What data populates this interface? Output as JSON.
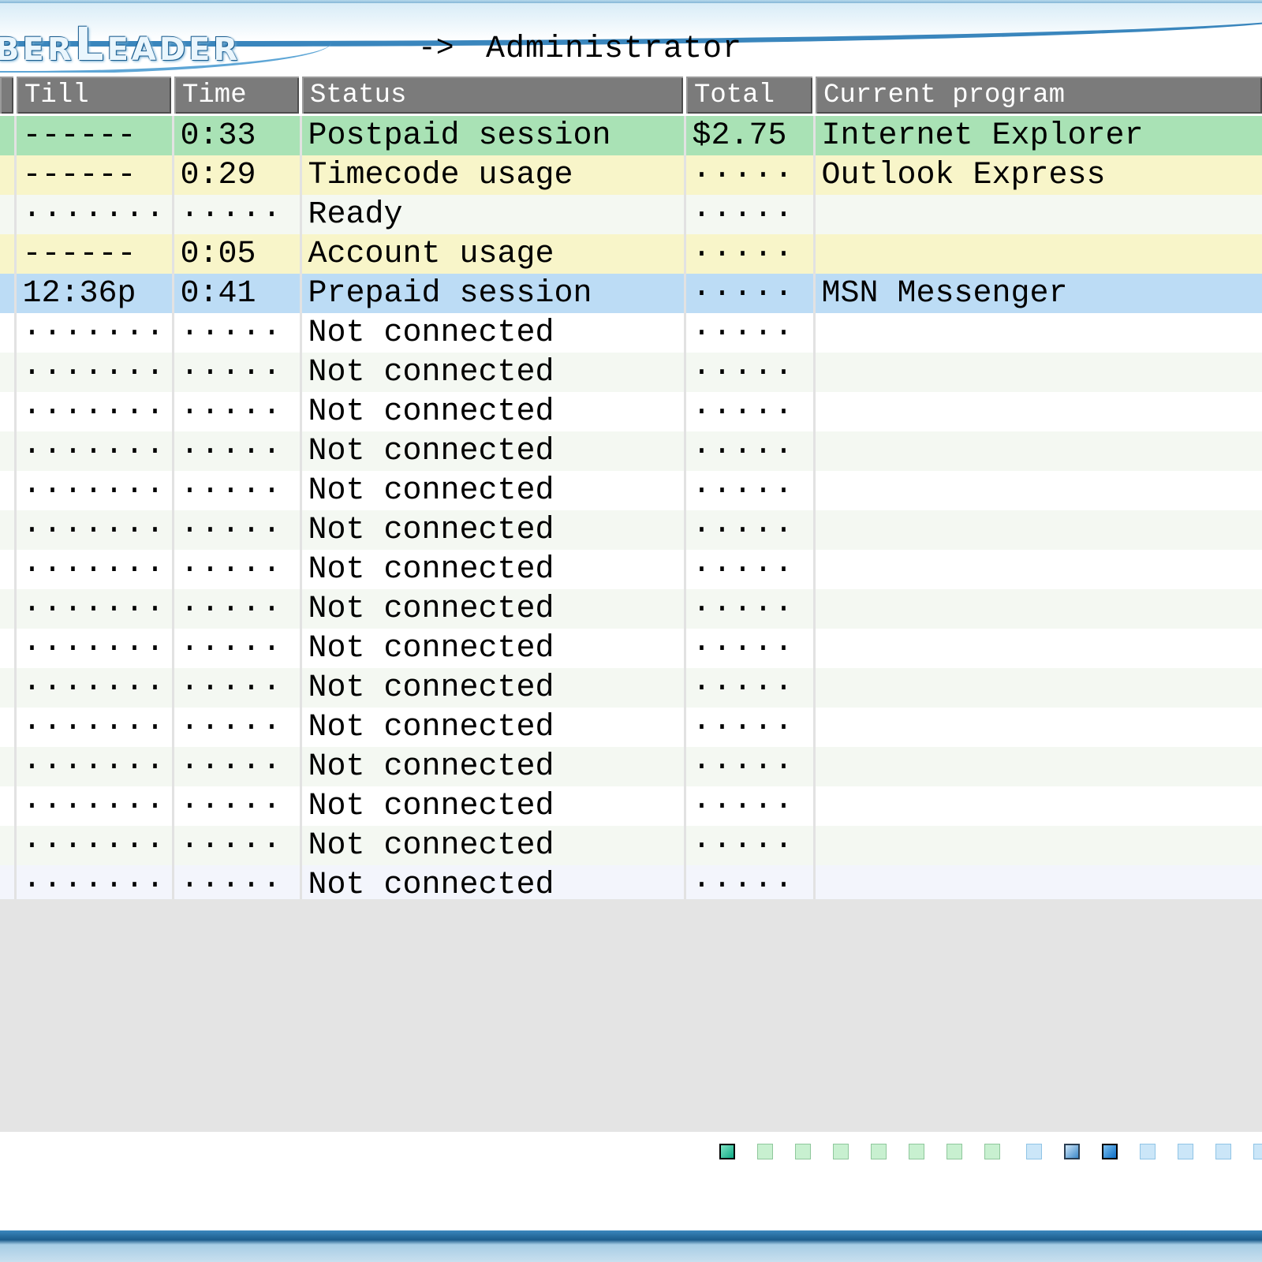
{
  "header": {
    "logo_prefix": "BER",
    "logo_big": "L",
    "logo_suffix": "EADER",
    "arrow": "->",
    "user": "Administrator"
  },
  "table": {
    "columns": [
      "Till",
      "Time",
      "Status",
      "Total",
      "Current program"
    ],
    "rows": [
      {
        "till": "------",
        "time": "0:33",
        "status": "Postpaid session",
        "total": "$2.75",
        "program": "Internet Explorer",
        "tone": "green"
      },
      {
        "till": "------",
        "time": "0:29",
        "status": "Timecode usage",
        "total": "·····",
        "program": "Outlook Express",
        "tone": "yellow"
      },
      {
        "till": "·······",
        "time": "·····",
        "status": "Ready",
        "total": "·····",
        "program": "",
        "tone": "light"
      },
      {
        "till": "------",
        "time": "0:05",
        "status": "Account usage",
        "total": "·····",
        "program": "",
        "tone": "yellow"
      },
      {
        "till": "12:36p",
        "time": "0:41",
        "status": "Prepaid session",
        "total": "·····",
        "program": "MSN Messenger",
        "tone": "blue"
      },
      {
        "till": "·······",
        "time": "·····",
        "status": "Not connected",
        "total": "·····",
        "program": "",
        "tone": "white"
      },
      {
        "till": "·······",
        "time": "·····",
        "status": "Not connected",
        "total": "·····",
        "program": "",
        "tone": "light"
      },
      {
        "till": "·······",
        "time": "·····",
        "status": "Not connected",
        "total": "·····",
        "program": "",
        "tone": "white"
      },
      {
        "till": "·······",
        "time": "·····",
        "status": "Not connected",
        "total": "·····",
        "program": "",
        "tone": "light"
      },
      {
        "till": "·······",
        "time": "·····",
        "status": "Not connected",
        "total": "·····",
        "program": "",
        "tone": "white"
      },
      {
        "till": "·······",
        "time": "·····",
        "status": "Not connected",
        "total": "·····",
        "program": "",
        "tone": "light"
      },
      {
        "till": "·······",
        "time": "·····",
        "status": "Not connected",
        "total": "·····",
        "program": "",
        "tone": "white"
      },
      {
        "till": "·······",
        "time": "·····",
        "status": "Not connected",
        "total": "·····",
        "program": "",
        "tone": "light"
      },
      {
        "till": "·······",
        "time": "·····",
        "status": "Not connected",
        "total": "·····",
        "program": "",
        "tone": "white"
      },
      {
        "till": "·······",
        "time": "·····",
        "status": "Not connected",
        "total": "·····",
        "program": "",
        "tone": "light"
      },
      {
        "till": "·······",
        "time": "·····",
        "status": "Not connected",
        "total": "·····",
        "program": "",
        "tone": "white"
      },
      {
        "till": "·······",
        "time": "·····",
        "status": "Not connected",
        "total": "·····",
        "program": "",
        "tone": "light"
      },
      {
        "till": "·······",
        "time": "·····",
        "status": "Not connected",
        "total": "·····",
        "program": "",
        "tone": "white"
      },
      {
        "till": "·······",
        "time": "·····",
        "status": "Not connected",
        "total": "·····",
        "program": "",
        "tone": "light"
      },
      {
        "till": "·······",
        "time": "·····",
        "status": "Not connected",
        "total": "·····",
        "program": "",
        "tone": "lavender"
      }
    ]
  },
  "indicators": [
    {
      "icon": "station-indicator-active",
      "style": "active"
    },
    {
      "icon": "station-indicator",
      "style": "green"
    },
    {
      "icon": "station-indicator",
      "style": "green"
    },
    {
      "icon": "station-indicator",
      "style": "green"
    },
    {
      "icon": "station-indicator",
      "style": "green"
    },
    {
      "icon": "station-indicator",
      "style": "green"
    },
    {
      "icon": "station-indicator",
      "style": "green"
    },
    {
      "icon": "station-indicator",
      "style": "green"
    },
    {
      "icon": "station-indicator",
      "style": "blue"
    },
    {
      "icon": "station-indicator",
      "style": "blue-mid"
    },
    {
      "icon": "station-indicator",
      "style": "blue-dark"
    },
    {
      "icon": "station-indicator",
      "style": "blue"
    },
    {
      "icon": "station-indicator",
      "style": "blue"
    },
    {
      "icon": "station-indicator",
      "style": "blue"
    },
    {
      "icon": "station-indicator",
      "style": "blue"
    }
  ],
  "colors": {
    "header_accent": "#3a86bd",
    "column_header_bg": "#7b7b7b",
    "row_postpaid": "#a9e2b5",
    "row_usage": "#f8f5c9",
    "row_prepaid": "#bcdcf5",
    "empty_area": "#e4e4e4"
  }
}
